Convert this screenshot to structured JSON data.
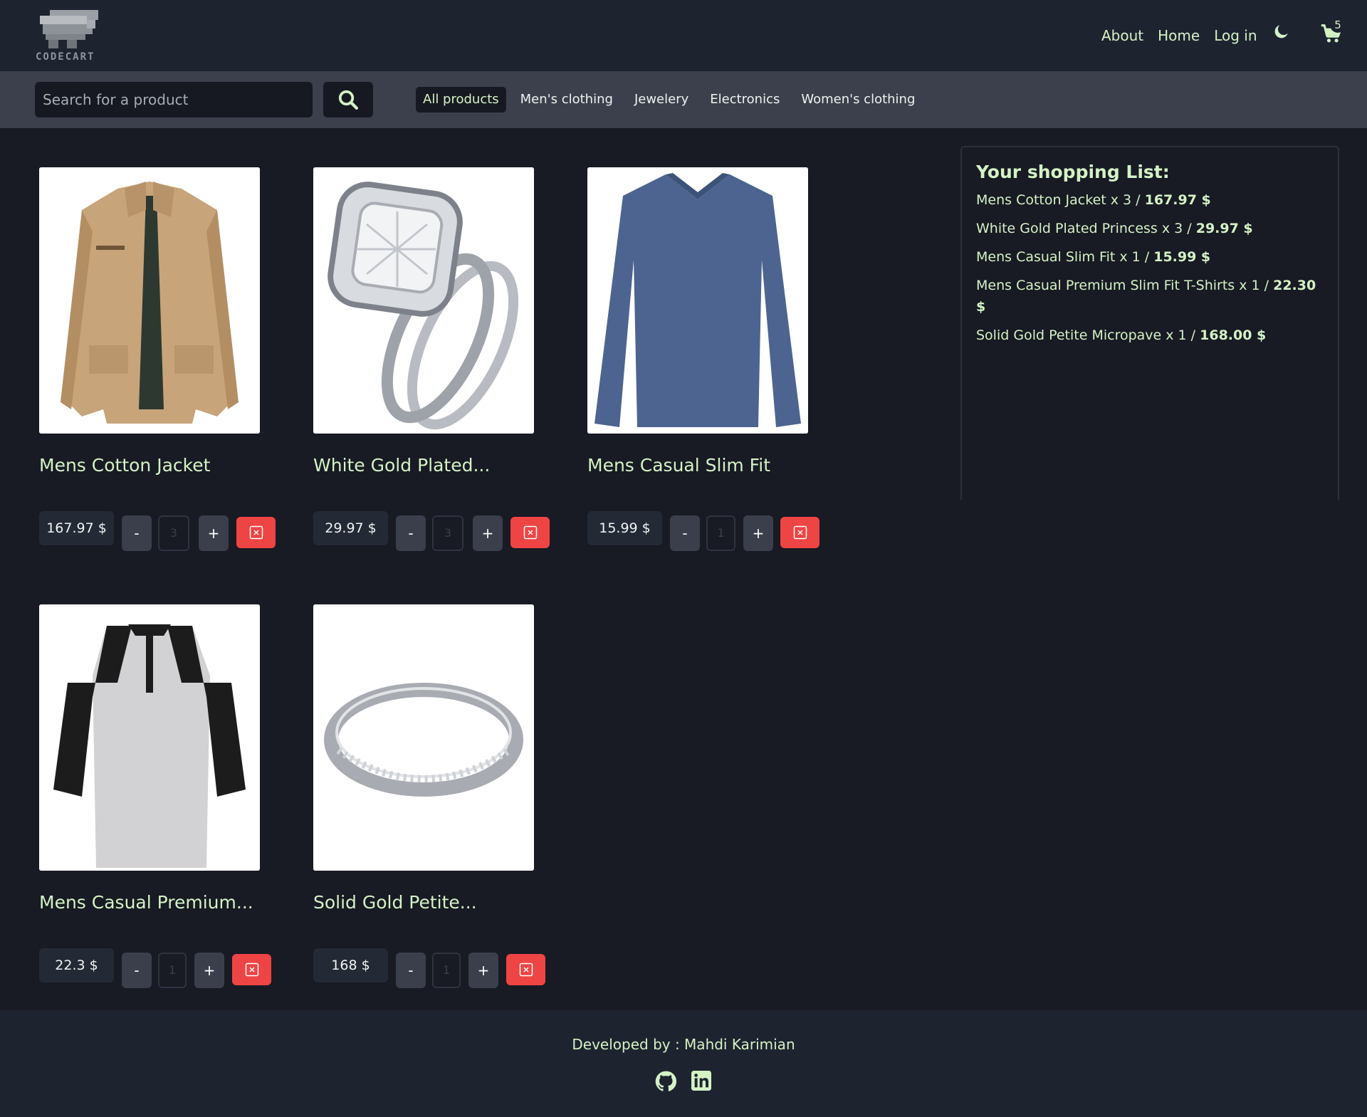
{
  "header": {
    "logo_text": "CODECART",
    "nav": [
      {
        "label": "About"
      },
      {
        "label": "Home"
      },
      {
        "label": "Log in"
      }
    ],
    "theme_icon": "moon-icon",
    "cart_icon": "cart-icon",
    "cart_count": "5"
  },
  "toolbar": {
    "search_placeholder": "Search for a product",
    "search_value": "",
    "search_icon": "search-icon",
    "categories": [
      {
        "label": "All products",
        "active": true
      },
      {
        "label": "Men's clothing",
        "active": false
      },
      {
        "label": "Jewelery",
        "active": false
      },
      {
        "label": "Electronics",
        "active": false
      },
      {
        "label": "Women's clothing",
        "active": false
      }
    ]
  },
  "products": [
    {
      "title": "Mens Cotton Jacket",
      "price": "167.97 $",
      "minus": "-",
      "plus": "+",
      "qty": "3",
      "image": "jacket"
    },
    {
      "title": "White Gold Plated...",
      "price": "29.97 $",
      "minus": "-",
      "plus": "+",
      "qty": "3",
      "image": "ring"
    },
    {
      "title": "Mens Casual Slim Fit",
      "price": "15.99 $",
      "minus": "-",
      "plus": "+",
      "qty": "1",
      "image": "tshirt"
    },
    {
      "title": "Mens Casual Premium...",
      "price": "22.3 $",
      "minus": "-",
      "plus": "+",
      "qty": "1",
      "image": "raglan"
    },
    {
      "title": "Solid Gold Petite...",
      "price": "168 $",
      "minus": "-",
      "plus": "+",
      "qty": "1",
      "image": "band"
    }
  ],
  "shopping_list": {
    "title": "Your shopping List:",
    "items": [
      {
        "text": "Mens Cotton Jacket x 3 / ",
        "total": "167.97 $"
      },
      {
        "text": "White Gold Plated Princess x 3 / ",
        "total": "29.97 $"
      },
      {
        "text": "Mens Casual Slim Fit x 1 / ",
        "total": "15.99 $"
      },
      {
        "text": "Mens Casual Premium Slim Fit T-Shirts x 1 / ",
        "total": "22.30 $"
      },
      {
        "text": "Solid Gold Petite Micropave x 1 / ",
        "total": "168.00 $"
      }
    ]
  },
  "footer": {
    "credit": "Developed by : Mahdi Karimian",
    "icons": [
      "github-icon",
      "linkedin-icon"
    ]
  },
  "colors": {
    "background": "#181a24",
    "header": "#1e2330",
    "toolbar": "#3b404c",
    "accent_text": "#d4f2c4",
    "danger": "#ef4444"
  }
}
